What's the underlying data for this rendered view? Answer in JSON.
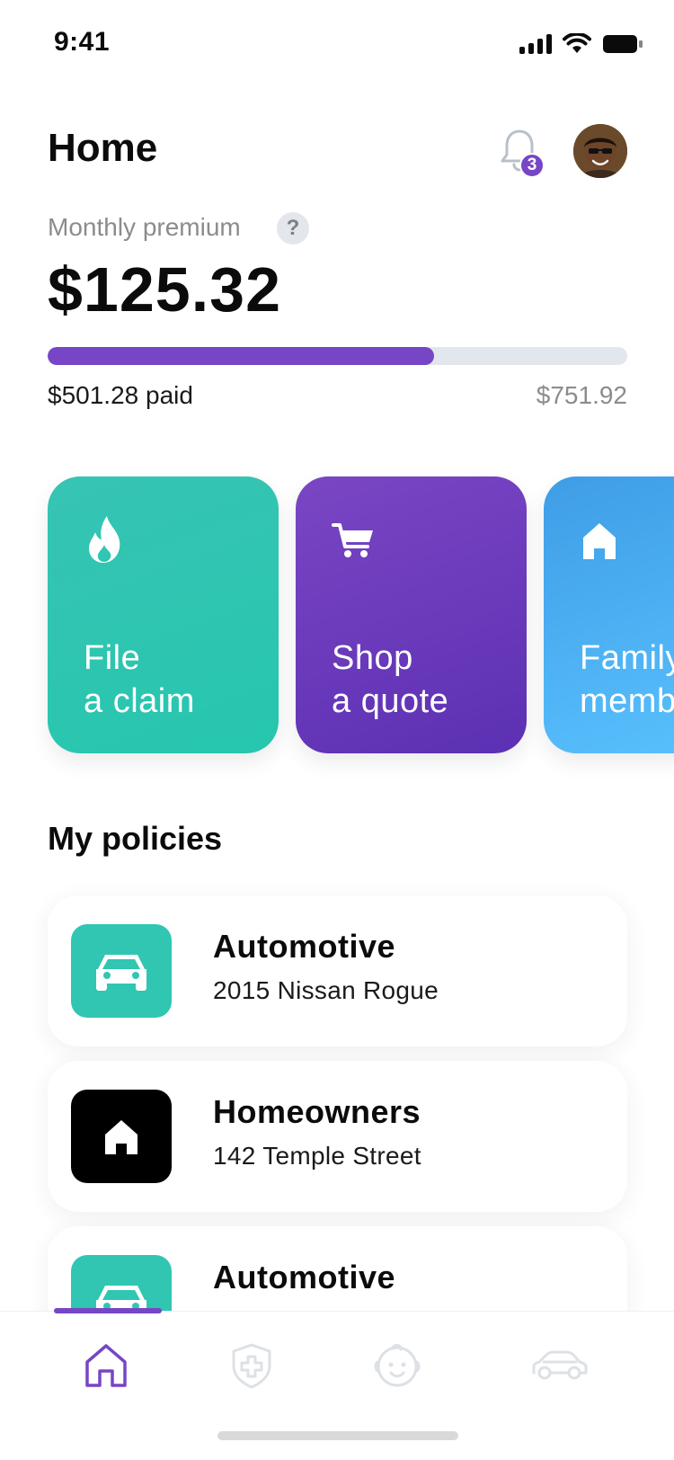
{
  "status_bar": {
    "time": "9:41"
  },
  "header": {
    "title": "Home",
    "notification_count": "3"
  },
  "premium": {
    "label": "Monthly premium",
    "help": "?",
    "amount": "$125.32",
    "paid_label": "$501.28 paid",
    "total_label": "$751.92",
    "progress_fraction": 0.667
  },
  "actions": [
    {
      "line1": "File",
      "line2": "a claim",
      "icon": "flame-icon",
      "color": "#2ec4b0"
    },
    {
      "line1": "Shop",
      "line2": "a quote",
      "icon": "cart-icon",
      "color": "#6a3cbc"
    },
    {
      "line1": "Family",
      "line2": "members",
      "icon": "home-icon",
      "color": "#4aaff0"
    }
  ],
  "policies": {
    "title": "My policies",
    "items": [
      {
        "title": "Automotive",
        "subtitle": "2015 Nissan Rogue",
        "icon": "car-icon"
      },
      {
        "title": "Homeowners",
        "subtitle": "142 Temple Street",
        "icon": "home-icon"
      },
      {
        "title": "Automotive",
        "subtitle": "",
        "icon": "car-icon"
      }
    ]
  },
  "tab_bar": {
    "items": [
      {
        "icon": "home-icon",
        "active": true
      },
      {
        "icon": "shield-plus-icon",
        "active": false
      },
      {
        "icon": "baby-face-icon",
        "active": false
      },
      {
        "icon": "car-icon",
        "active": false
      }
    ]
  },
  "colors": {
    "accent": "#7646c6",
    "teal": "#30c6b2",
    "track": "#e2e7ed"
  }
}
